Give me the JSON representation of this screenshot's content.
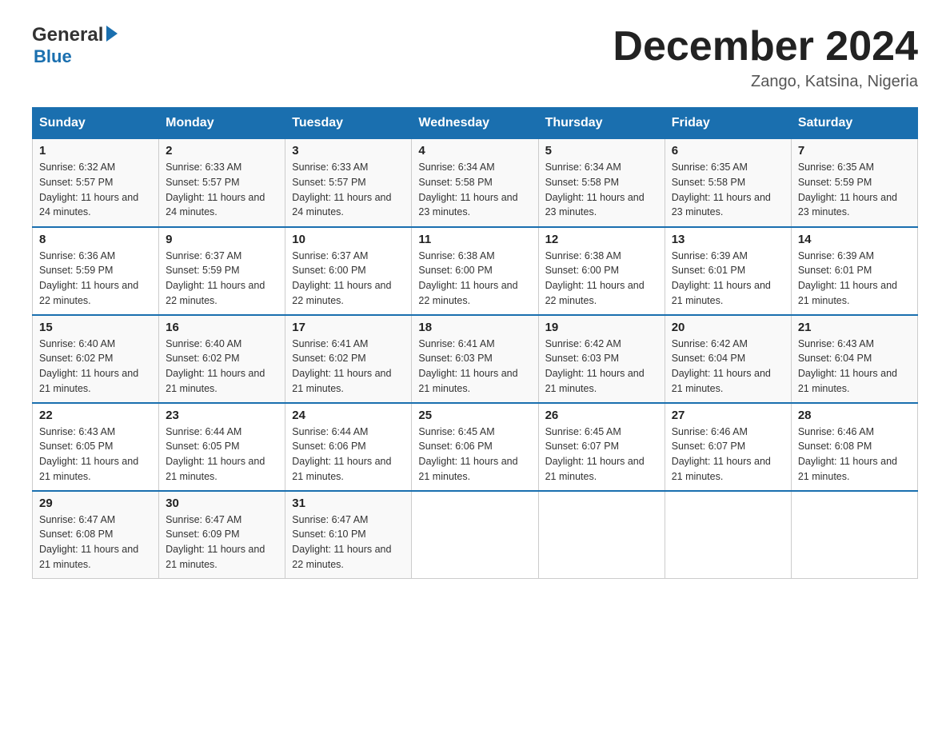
{
  "logo": {
    "general": "General",
    "blue": "Blue"
  },
  "header": {
    "month_year": "December 2024",
    "location": "Zango, Katsina, Nigeria"
  },
  "days_of_week": [
    "Sunday",
    "Monday",
    "Tuesday",
    "Wednesday",
    "Thursday",
    "Friday",
    "Saturday"
  ],
  "weeks": [
    [
      {
        "day": "1",
        "sunrise": "6:32 AM",
        "sunset": "5:57 PM",
        "daylight": "11 hours and 24 minutes."
      },
      {
        "day": "2",
        "sunrise": "6:33 AM",
        "sunset": "5:57 PM",
        "daylight": "11 hours and 24 minutes."
      },
      {
        "day": "3",
        "sunrise": "6:33 AM",
        "sunset": "5:57 PM",
        "daylight": "11 hours and 24 minutes."
      },
      {
        "day": "4",
        "sunrise": "6:34 AM",
        "sunset": "5:58 PM",
        "daylight": "11 hours and 23 minutes."
      },
      {
        "day": "5",
        "sunrise": "6:34 AM",
        "sunset": "5:58 PM",
        "daylight": "11 hours and 23 minutes."
      },
      {
        "day": "6",
        "sunrise": "6:35 AM",
        "sunset": "5:58 PM",
        "daylight": "11 hours and 23 minutes."
      },
      {
        "day": "7",
        "sunrise": "6:35 AM",
        "sunset": "5:59 PM",
        "daylight": "11 hours and 23 minutes."
      }
    ],
    [
      {
        "day": "8",
        "sunrise": "6:36 AM",
        "sunset": "5:59 PM",
        "daylight": "11 hours and 22 minutes."
      },
      {
        "day": "9",
        "sunrise": "6:37 AM",
        "sunset": "5:59 PM",
        "daylight": "11 hours and 22 minutes."
      },
      {
        "day": "10",
        "sunrise": "6:37 AM",
        "sunset": "6:00 PM",
        "daylight": "11 hours and 22 minutes."
      },
      {
        "day": "11",
        "sunrise": "6:38 AM",
        "sunset": "6:00 PM",
        "daylight": "11 hours and 22 minutes."
      },
      {
        "day": "12",
        "sunrise": "6:38 AM",
        "sunset": "6:00 PM",
        "daylight": "11 hours and 22 minutes."
      },
      {
        "day": "13",
        "sunrise": "6:39 AM",
        "sunset": "6:01 PM",
        "daylight": "11 hours and 21 minutes."
      },
      {
        "day": "14",
        "sunrise": "6:39 AM",
        "sunset": "6:01 PM",
        "daylight": "11 hours and 21 minutes."
      }
    ],
    [
      {
        "day": "15",
        "sunrise": "6:40 AM",
        "sunset": "6:02 PM",
        "daylight": "11 hours and 21 minutes."
      },
      {
        "day": "16",
        "sunrise": "6:40 AM",
        "sunset": "6:02 PM",
        "daylight": "11 hours and 21 minutes."
      },
      {
        "day": "17",
        "sunrise": "6:41 AM",
        "sunset": "6:02 PM",
        "daylight": "11 hours and 21 minutes."
      },
      {
        "day": "18",
        "sunrise": "6:41 AM",
        "sunset": "6:03 PM",
        "daylight": "11 hours and 21 minutes."
      },
      {
        "day": "19",
        "sunrise": "6:42 AM",
        "sunset": "6:03 PM",
        "daylight": "11 hours and 21 minutes."
      },
      {
        "day": "20",
        "sunrise": "6:42 AM",
        "sunset": "6:04 PM",
        "daylight": "11 hours and 21 minutes."
      },
      {
        "day": "21",
        "sunrise": "6:43 AM",
        "sunset": "6:04 PM",
        "daylight": "11 hours and 21 minutes."
      }
    ],
    [
      {
        "day": "22",
        "sunrise": "6:43 AM",
        "sunset": "6:05 PM",
        "daylight": "11 hours and 21 minutes."
      },
      {
        "day": "23",
        "sunrise": "6:44 AM",
        "sunset": "6:05 PM",
        "daylight": "11 hours and 21 minutes."
      },
      {
        "day": "24",
        "sunrise": "6:44 AM",
        "sunset": "6:06 PM",
        "daylight": "11 hours and 21 minutes."
      },
      {
        "day": "25",
        "sunrise": "6:45 AM",
        "sunset": "6:06 PM",
        "daylight": "11 hours and 21 minutes."
      },
      {
        "day": "26",
        "sunrise": "6:45 AM",
        "sunset": "6:07 PM",
        "daylight": "11 hours and 21 minutes."
      },
      {
        "day": "27",
        "sunrise": "6:46 AM",
        "sunset": "6:07 PM",
        "daylight": "11 hours and 21 minutes."
      },
      {
        "day": "28",
        "sunrise": "6:46 AM",
        "sunset": "6:08 PM",
        "daylight": "11 hours and 21 minutes."
      }
    ],
    [
      {
        "day": "29",
        "sunrise": "6:47 AM",
        "sunset": "6:08 PM",
        "daylight": "11 hours and 21 minutes."
      },
      {
        "day": "30",
        "sunrise": "6:47 AM",
        "sunset": "6:09 PM",
        "daylight": "11 hours and 21 minutes."
      },
      {
        "day": "31",
        "sunrise": "6:47 AM",
        "sunset": "6:10 PM",
        "daylight": "11 hours and 22 minutes."
      },
      null,
      null,
      null,
      null
    ]
  ]
}
